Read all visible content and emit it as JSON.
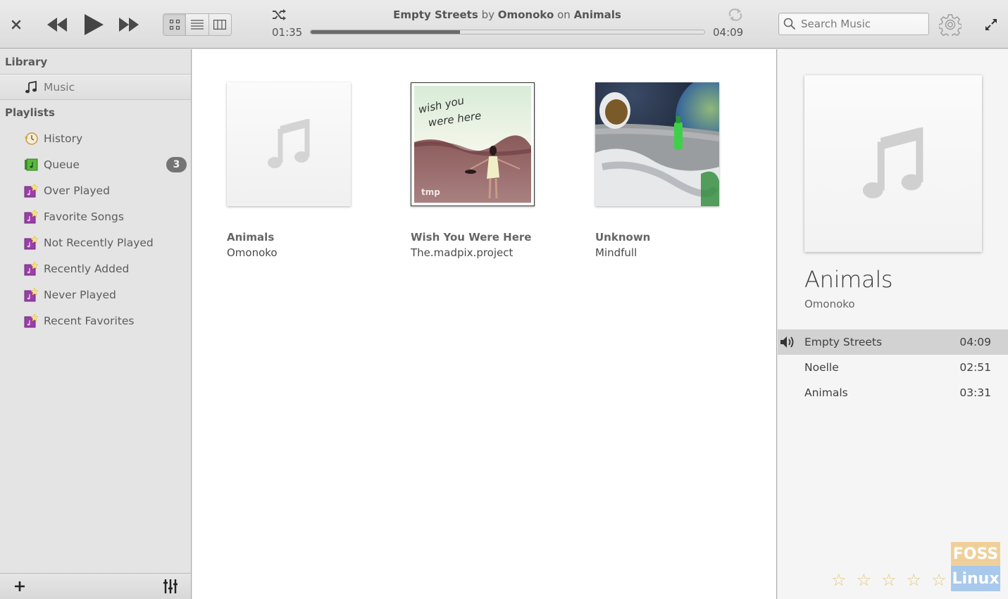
{
  "header": {
    "close_label": "×",
    "now_playing": {
      "title": "Empty Streets",
      "by_label": "by",
      "artist": "Omonoko",
      "on_label": "on",
      "album": "Animals"
    },
    "elapsed": "01:35",
    "total": "04:09",
    "progress_fraction": 0.38,
    "search": {
      "placeholder": "Search Music",
      "value": ""
    },
    "view_modes": [
      "grid",
      "list",
      "columns"
    ],
    "active_view": "grid"
  },
  "sidebar": {
    "library_label": "Library",
    "library_items": [
      {
        "label": "Music",
        "icon": "music-note-icon"
      }
    ],
    "playlists_label": "Playlists",
    "playlists": [
      {
        "label": "History",
        "icon": "history-clock-icon"
      },
      {
        "label": "Queue",
        "icon": "queue-icon",
        "badge": "3"
      },
      {
        "label": "Over Played",
        "icon": "smart-playlist-icon"
      },
      {
        "label": "Favorite Songs",
        "icon": "smart-playlist-icon"
      },
      {
        "label": "Not Recently Played",
        "icon": "smart-playlist-icon"
      },
      {
        "label": "Recently Added",
        "icon": "smart-playlist-icon"
      },
      {
        "label": "Never Played",
        "icon": "smart-playlist-icon"
      },
      {
        "label": "Recent Favorites",
        "icon": "smart-playlist-icon"
      }
    ],
    "footer": {
      "add_label": "+"
    }
  },
  "albums": [
    {
      "title": "Animals",
      "artist": "Omonoko",
      "cover": "placeholder"
    },
    {
      "title": "Wish You Were Here",
      "artist": "The.madpix.project",
      "cover": "wish-you-were-here-art",
      "cover_text": "wish you were here",
      "cover_logo": "tmp"
    },
    {
      "title": "Unknown",
      "artist": "Mindfull",
      "cover": "astronaut-moon-art"
    }
  ],
  "info_panel": {
    "album": "Animals",
    "artist": "Omonoko",
    "tracks": [
      {
        "name": "Empty Streets",
        "duration": "04:09",
        "playing": true
      },
      {
        "name": "Noelle",
        "duration": "02:51",
        "playing": false
      },
      {
        "name": "Animals",
        "duration": "03:31",
        "playing": false
      }
    ],
    "rating": {
      "value": 0,
      "max": 5
    }
  },
  "watermark": {
    "top": "FOSS",
    "bottom": "Linux"
  },
  "colors": {
    "star": "#e3c778",
    "playing_row": "#d2d2d2",
    "badge": "#747474",
    "progress_fill": "#6a6a6a"
  }
}
